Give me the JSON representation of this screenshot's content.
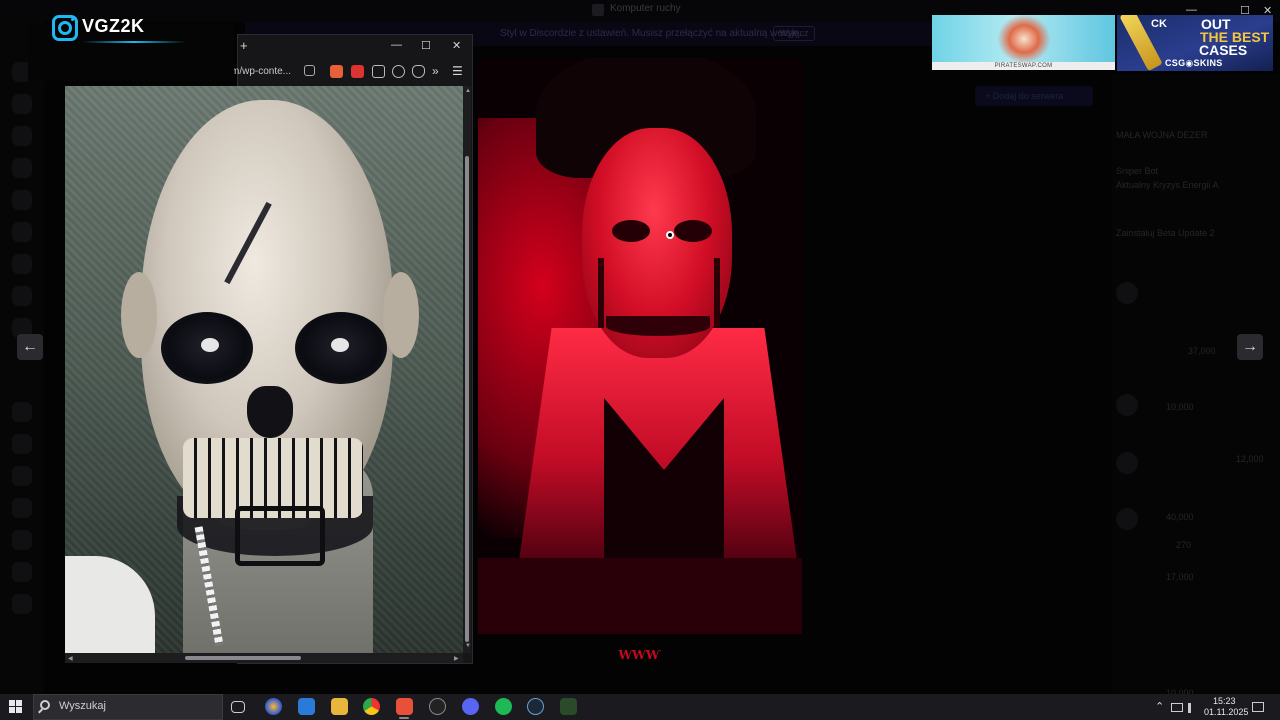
{
  "background_app": {
    "window_title": "Komputer ruchy",
    "notice": "Styl w Discordzie z ustawień. Musisz przełączyć na aktualną wersję.",
    "notice_button": "Wyłącz",
    "top_button": "+ Dodaj do serwera",
    "members": [
      "MAŁA WOJNA DEZER",
      "Sniper Bot",
      "Aktualny Kryzys Energii A",
      "Zainstaluj Beta Update 2"
    ],
    "amounts": [
      "37,000",
      "10,000",
      "12,000",
      "40,000",
      "270",
      "17,000",
      "10,000"
    ]
  },
  "window_controls": {
    "minimize": "—",
    "maximize": "☐",
    "close": "✕"
  },
  "ads": {
    "pirate": {
      "label": "PIRATESWAP.COM"
    },
    "csgo": {
      "left_text": "CK",
      "out": "OUT",
      "best": "THE BEST",
      "cases": "CASES",
      "brand": "CSG◉SKINS"
    }
  },
  "browser": {
    "new_tab": "+",
    "minimize": "—",
    "maximize": "☐",
    "close": "✕",
    "url": "m/wp-conte...",
    "more": "»",
    "menu": "☰"
  },
  "overlay": {
    "handle": "VGZ2K"
  },
  "navigation": {
    "prev": "←",
    "next": "→"
  },
  "watermark": {
    "text": "ⱲⱲⱲ"
  },
  "taskbar": {
    "search_placeholder": "Wyszukaj",
    "time": "15:23",
    "date": "01.11.2025",
    "tray_chevron": "⌃"
  }
}
